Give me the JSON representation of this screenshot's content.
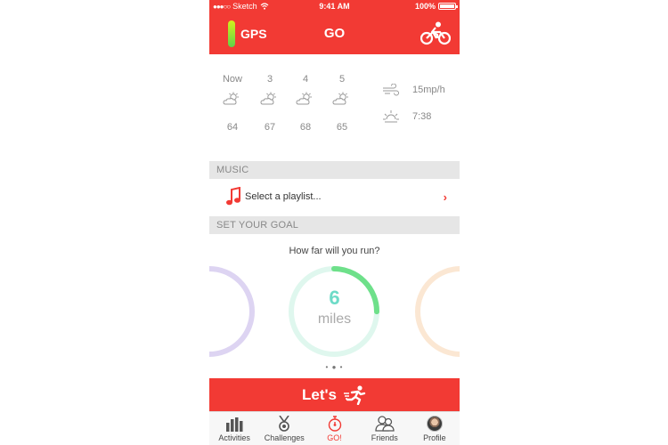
{
  "status_bar": {
    "carrier": "Sketch",
    "time": "9:41 AM",
    "battery": "100%"
  },
  "nav": {
    "gps_label": "GPS",
    "title": "GO"
  },
  "weather": {
    "columns": [
      {
        "hour": "Now",
        "temp": "64",
        "icon": "partly-cloudy-icon"
      },
      {
        "hour": "3",
        "temp": "67",
        "icon": "partly-cloudy-icon"
      },
      {
        "hour": "4",
        "temp": "68",
        "icon": "partly-cloudy-icon"
      },
      {
        "hour": "5",
        "temp": "65",
        "icon": "partly-cloudy-icon"
      }
    ],
    "wind": "15mp/h",
    "sunset": "7:38"
  },
  "music": {
    "header": "MUSIC",
    "row_label": "Select a playlist..."
  },
  "goal": {
    "header": "SET YOUR GOAL",
    "question": "How far will you run?",
    "value": "6",
    "unit": "miles",
    "progress_fraction": 0.25
  },
  "cta": {
    "label": "Let's"
  },
  "tabs": [
    {
      "label": "Activities",
      "icon": "bar-chart-icon"
    },
    {
      "label": "Challenges",
      "icon": "medal-icon"
    },
    {
      "label": "GO!",
      "icon": "stopwatch-icon",
      "active": true
    },
    {
      "label": "Friends",
      "icon": "friends-icon"
    },
    {
      "label": "Profile",
      "icon": "avatar"
    }
  ],
  "colors": {
    "accent": "#f23a34",
    "goal": "#6ddbc7",
    "gps_gradient": [
      "#d4f21b",
      "#5fd34a"
    ]
  }
}
